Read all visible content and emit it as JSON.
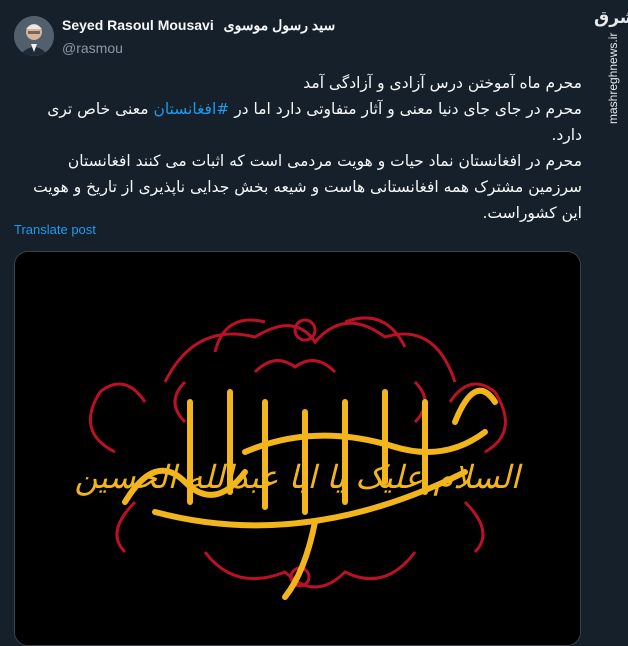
{
  "author": {
    "display_name_en": "Seyed Rasoul Mousavi",
    "display_name_fa": "سید رسول موسوی",
    "handle": "@rasmou",
    "avatar_icon": "person-portrait-avatar"
  },
  "tweet": {
    "line1": "محرم ماه آموختن درس آزادی و آزادگی آمد",
    "line2_before": "محرم در جای جای دنیا معنی و آثار متفاوتی دارد اما در ",
    "hashtag": "#افغانستان",
    "line2_after": " معنی خاص تری دارد.",
    "line3": "محرم در افغانستان نماد حیات و هویت مردمی است که اثبات می کنند افغانستان سرزمین مشترک همه افغانستانی هاست و شیعه بخش جدایی ناپذیری از تاریخ و هویت این کشوراست.",
    "hashtag_color": "#1d9bf0"
  },
  "translate_label": "Translate post",
  "media": {
    "calligraphy": "السلام علیک یا ابا عبدالله الحسین",
    "background_color": "#000000",
    "ornament_color": "#c4122a",
    "calligraphy_color": "#f2b51c"
  },
  "watermark": {
    "logo": "مشرق",
    "site": "mashreghnews.ir"
  }
}
